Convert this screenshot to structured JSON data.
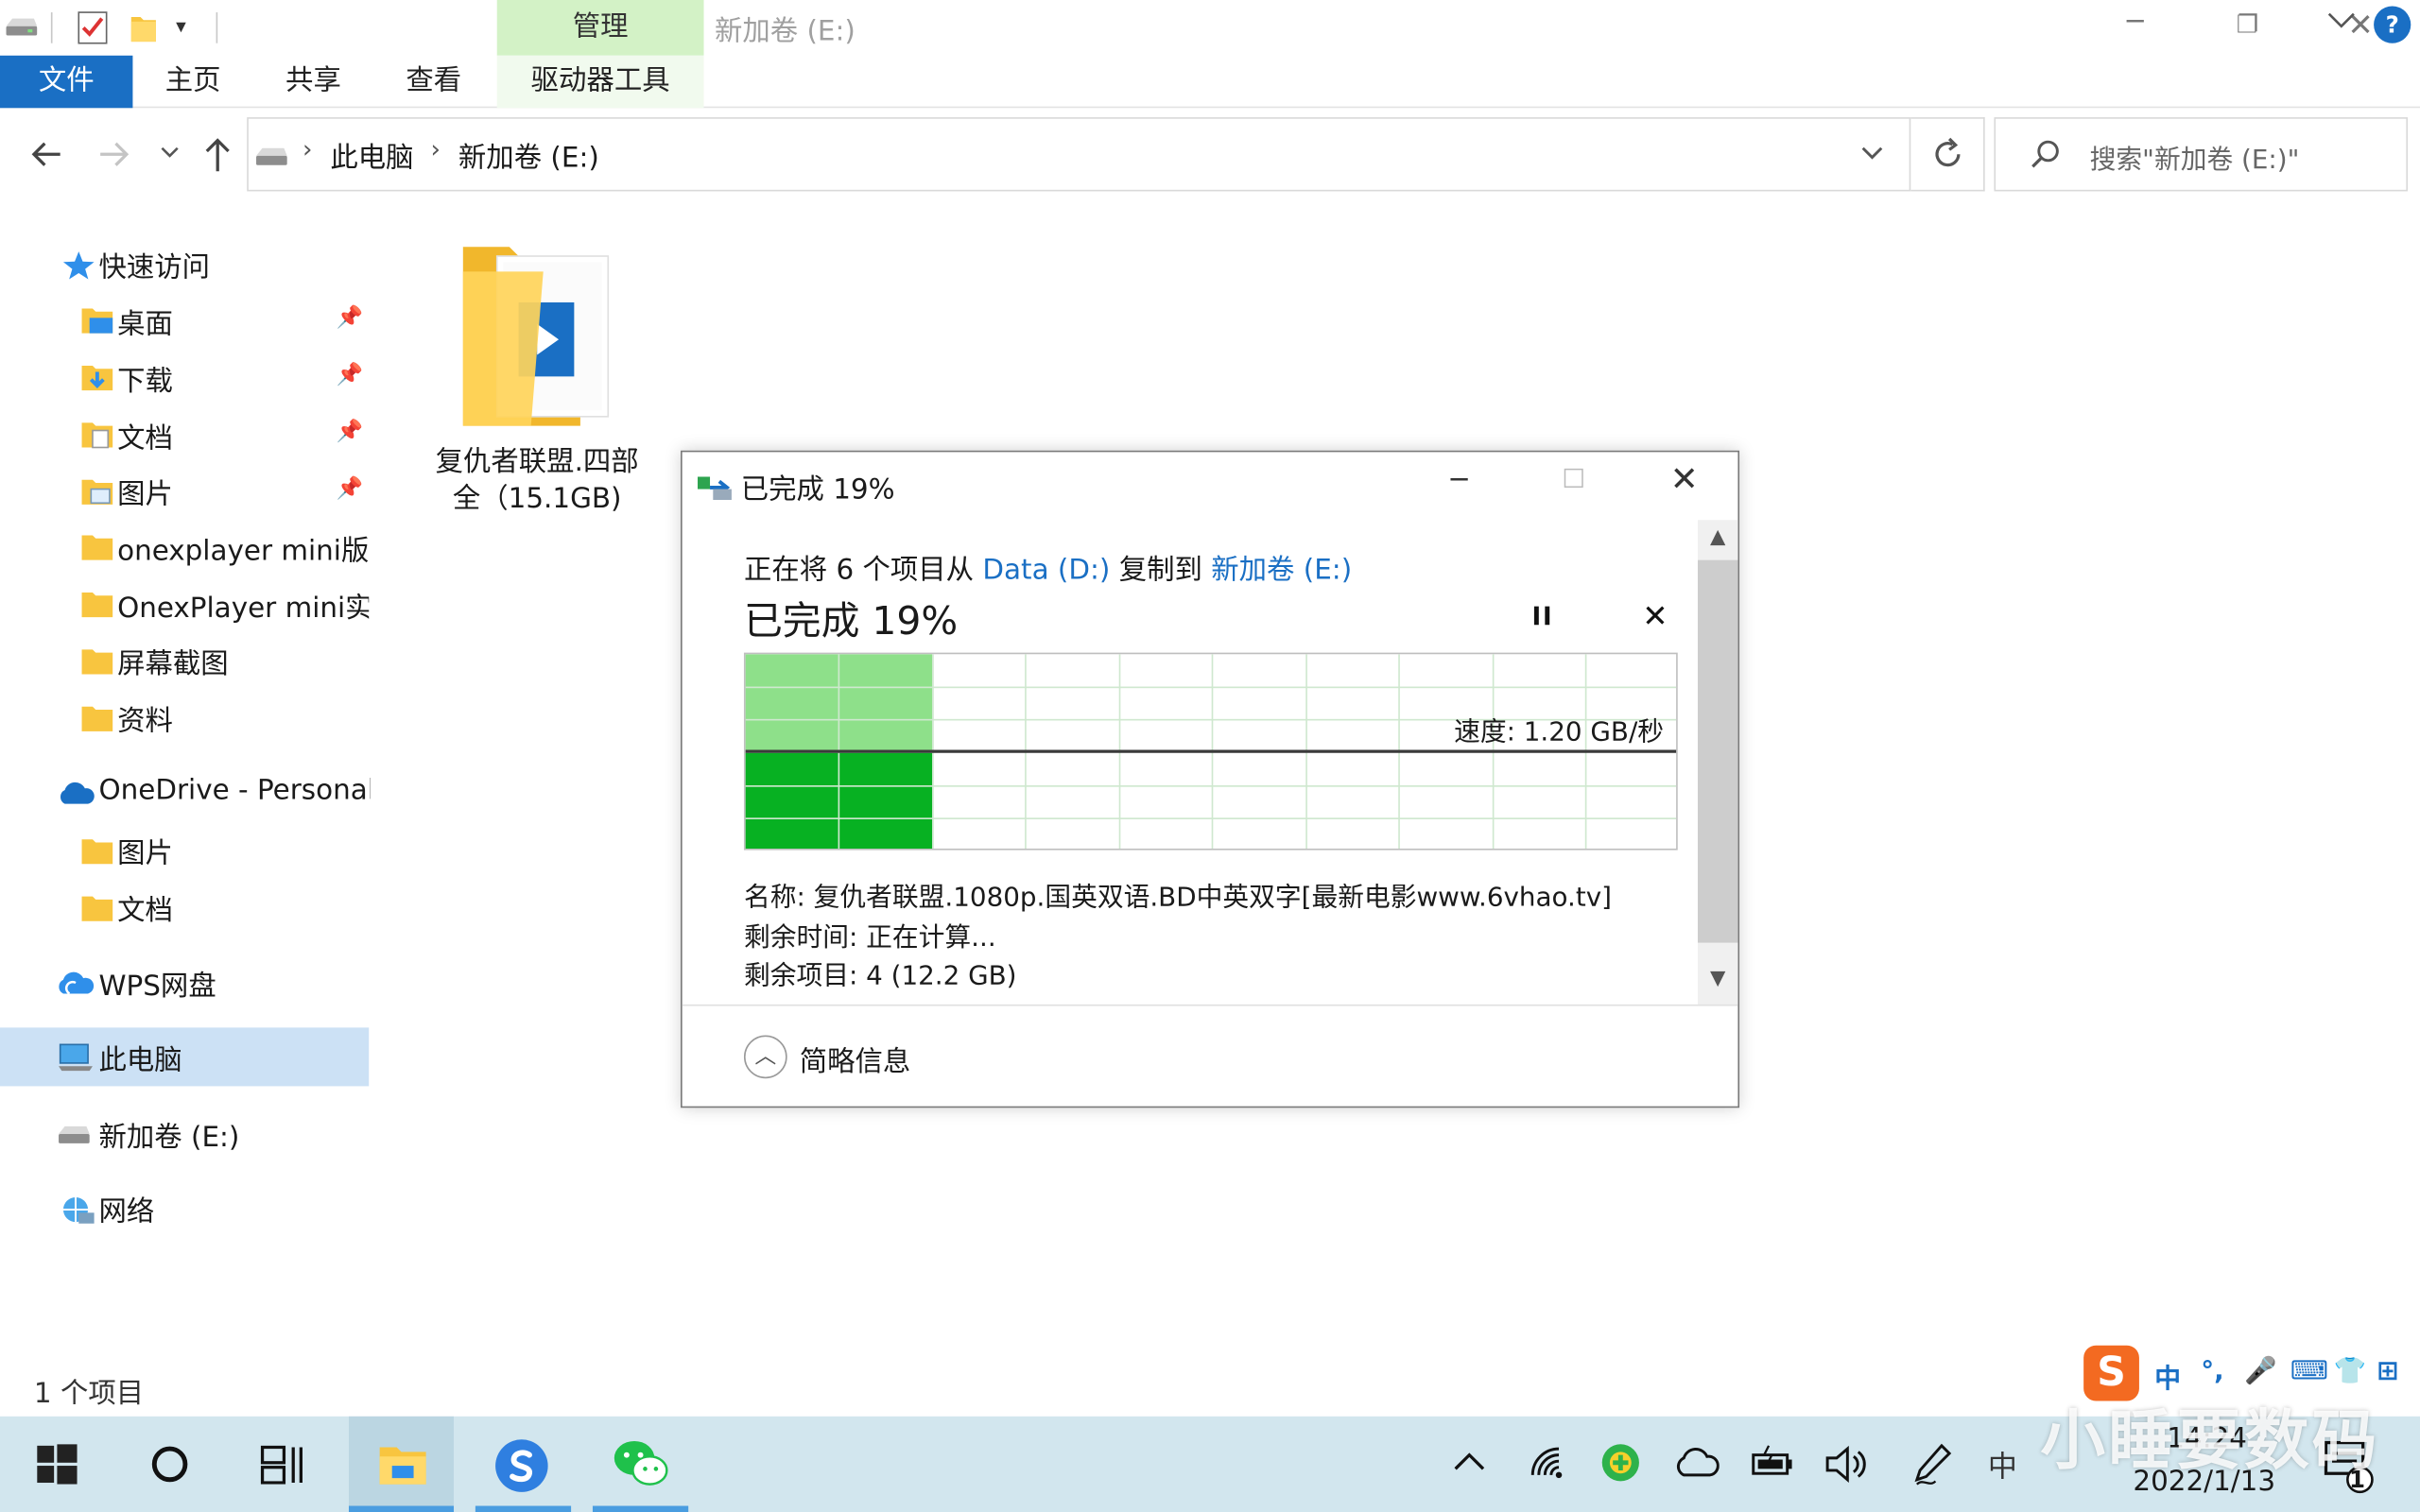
{
  "window": {
    "title": "新加卷 (E:)",
    "manage_tab": "管理",
    "min": "─",
    "max": "❐",
    "close": "✕"
  },
  "ribbon": {
    "tabs": [
      "文件",
      "主页",
      "共享",
      "查看",
      "驱动器工具"
    ],
    "help": "?"
  },
  "address": {
    "crumbs": [
      "此电脑",
      "新加卷 (E:)"
    ],
    "separator": "›",
    "search_placeholder": "搜索\"新加卷 (E:)\""
  },
  "sidebar": {
    "quick_access": "快速访问",
    "quick_items": [
      "桌面",
      "下载",
      "文档",
      "图片",
      "onexplayer mini版",
      "OnexPlayer mini实",
      "屏幕截图",
      "资料"
    ],
    "onedrive": "OneDrive - Personal",
    "onedrive_items": [
      "图片",
      "文档"
    ],
    "wps": "WPS网盘",
    "this_pc": "此电脑",
    "drive": "新加卷 (E:)",
    "network": "网络"
  },
  "content": {
    "file_name": "复仇者联盟.四部全（15.1GB)"
  },
  "dialog": {
    "title": "已完成 19%",
    "desc_prefix": "正在将 6 个项目从 ",
    "source": "Data (D:)",
    "desc_middle": " 复制到 ",
    "destination": "新加卷 (E:)",
    "percent_label": "已完成 19%",
    "progress": 0.19,
    "speed": "速度: 1.20 GB/秒",
    "name": "名称: 复仇者联盟.1080p.国英双语.BD中英双字[最新电影www.6vhao.tv]",
    "remaining_time": "剩余时间: 正在计算...",
    "remaining_items": "剩余项目: 4 (12.2 GB)",
    "more_label": "简略信息",
    "min": "─",
    "max": "☐",
    "close": "✕",
    "cancel": "✕"
  },
  "status": {
    "item_count": "1 个项目"
  },
  "ime": {
    "logo": "S",
    "items": [
      "中",
      "°,",
      "🎤",
      "⌨",
      "👕",
      "⊞"
    ]
  },
  "taskbar": {
    "time": "14:24",
    "date": "2022/1/13",
    "ime_mode": "中",
    "notification_count": "1"
  },
  "watermark": "小睡要数码",
  "colors": {
    "accent": "#1a6fc4",
    "manage_tab": "#d3f2c6",
    "progress_light": "#8ee08a",
    "progress_dark": "#07b122",
    "taskbar": "#d2e6ee"
  }
}
